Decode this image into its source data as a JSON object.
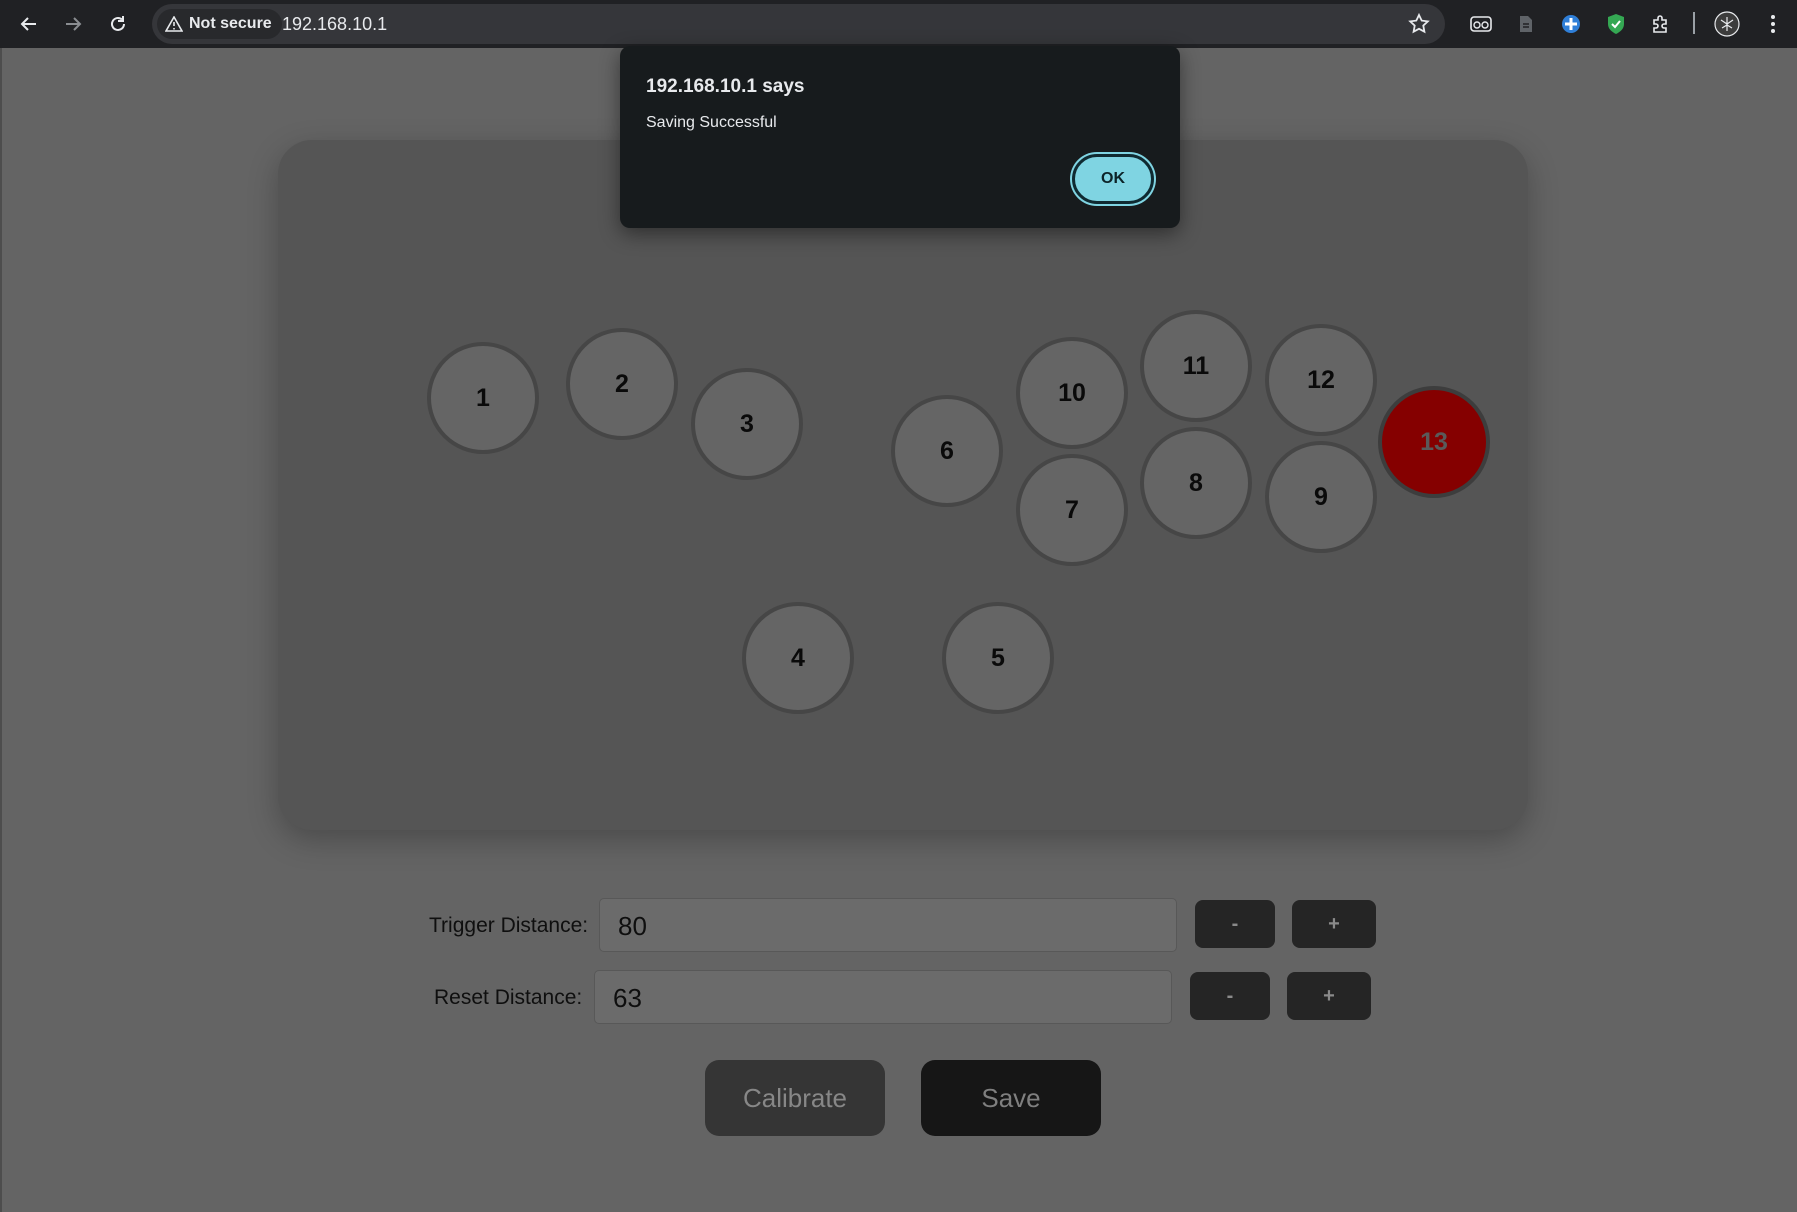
{
  "browser": {
    "security_label": "Not secure",
    "url": "192.168.10.1"
  },
  "dialog": {
    "title": "192.168.10.1 says",
    "message": "Saving Successful",
    "ok_label": "OK"
  },
  "keys": [
    {
      "label": "1",
      "active": false
    },
    {
      "label": "2",
      "active": false
    },
    {
      "label": "3",
      "active": false
    },
    {
      "label": "4",
      "active": false
    },
    {
      "label": "5",
      "active": false
    },
    {
      "label": "6",
      "active": false
    },
    {
      "label": "7",
      "active": false
    },
    {
      "label": "8",
      "active": false
    },
    {
      "label": "9",
      "active": false
    },
    {
      "label": "10",
      "active": false
    },
    {
      "label": "11",
      "active": false
    },
    {
      "label": "12",
      "active": false
    },
    {
      "label": "13",
      "active": true
    }
  ],
  "active_key_color": "#850000",
  "settings": {
    "trigger": {
      "label": "Trigger Distance:",
      "value": "80",
      "minus": "-",
      "plus": "+"
    },
    "reset": {
      "label": "Reset Distance:",
      "value": "63",
      "minus": "-",
      "plus": "+"
    }
  },
  "actions": {
    "calibrate_label": "Calibrate",
    "save_label": "Save"
  }
}
